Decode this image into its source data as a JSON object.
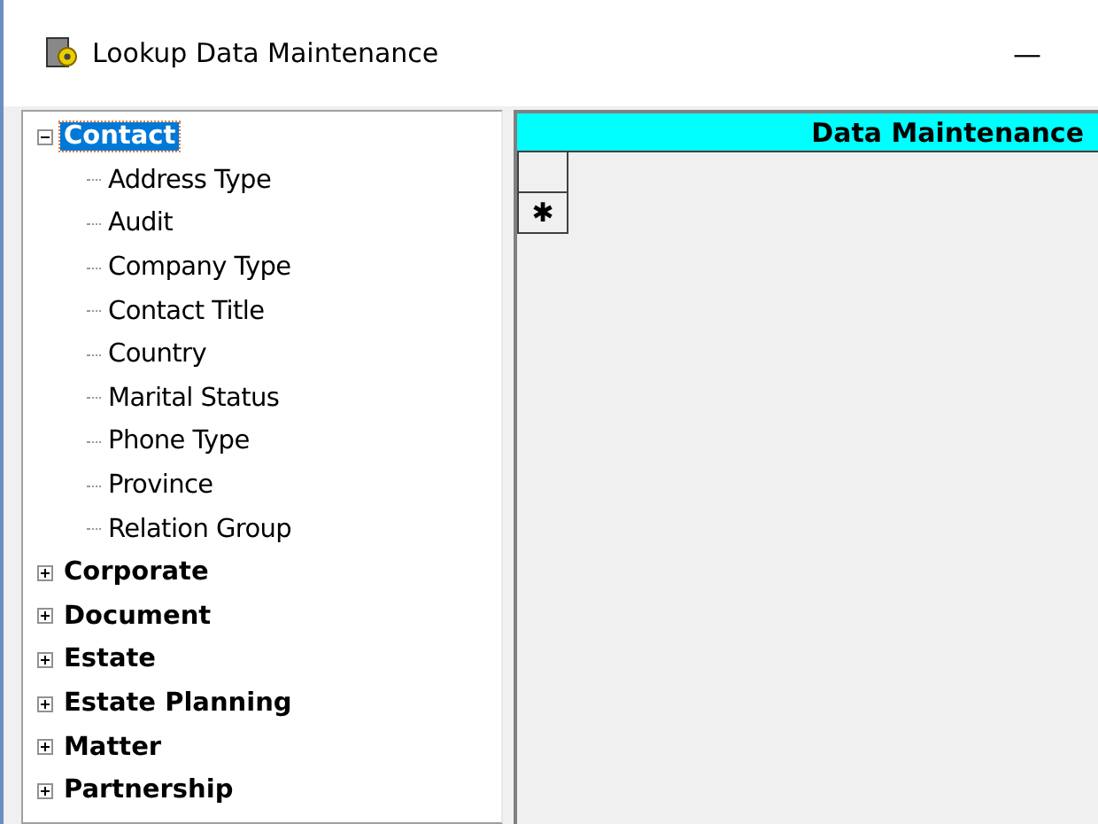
{
  "window": {
    "title": "Lookup Data Maintenance",
    "minimize": "—"
  },
  "tree": [
    {
      "label": "Contact",
      "expanded": true,
      "selected": true,
      "children": [
        {
          "label": "Address Type",
          "selected": false
        },
        {
          "label": "Audit",
          "selected": false
        },
        {
          "label": "Company Type",
          "selected": false
        },
        {
          "label": "Contact Title",
          "selected": false
        },
        {
          "label": "Country",
          "selected": false
        },
        {
          "label": "Marital Status",
          "selected": false
        },
        {
          "label": "Phone Type",
          "selected": false
        },
        {
          "label": "Province",
          "selected": false
        },
        {
          "label": "Relation Group",
          "selected": false
        }
      ]
    },
    {
      "label": "Corporate",
      "expanded": false,
      "selected": false
    },
    {
      "label": "Document",
      "expanded": false,
      "selected": false
    },
    {
      "label": "Estate",
      "expanded": false,
      "selected": false
    },
    {
      "label": "Estate Planning",
      "expanded": false,
      "selected": false
    },
    {
      "label": "Matter",
      "expanded": false,
      "selected": false
    },
    {
      "label": "Partnership",
      "expanded": false,
      "selected": false
    }
  ],
  "grid": {
    "title": "Data Maintenance",
    "row_headers": [
      {
        "kind": "blank"
      },
      {
        "kind": "new",
        "marker": "✱"
      }
    ]
  }
}
